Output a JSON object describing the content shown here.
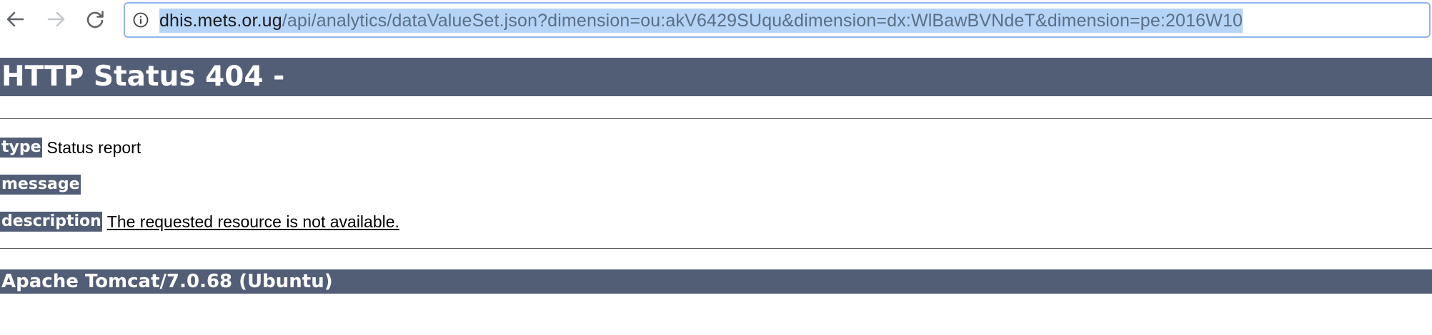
{
  "browser": {
    "url_host": "dhis.mets.or.ug",
    "url_path": "/api/analytics/dataValueSet.json?dimension=ou:akV6429SUqu&dimension=dx:WlBawBVNdeT&dimension=pe:2016W10",
    "icons": {
      "back": "arrow-left-icon",
      "forward": "arrow-right-icon",
      "reload": "reload-icon",
      "info": "info-circle-icon"
    }
  },
  "page": {
    "heading": "HTTP Status 404 -",
    "fields": [
      {
        "label": "type",
        "value": "Status report"
      },
      {
        "label": "message",
        "value": ""
      },
      {
        "label": "description",
        "value": "The requested resource is not available."
      }
    ],
    "footer": "Apache Tomcat/7.0.68 (Ubuntu)"
  },
  "colors": {
    "tomcat_header_bg": "#525d76",
    "url_selection": "#b5d4f6",
    "omnibox_border": "#8fb6ec"
  }
}
